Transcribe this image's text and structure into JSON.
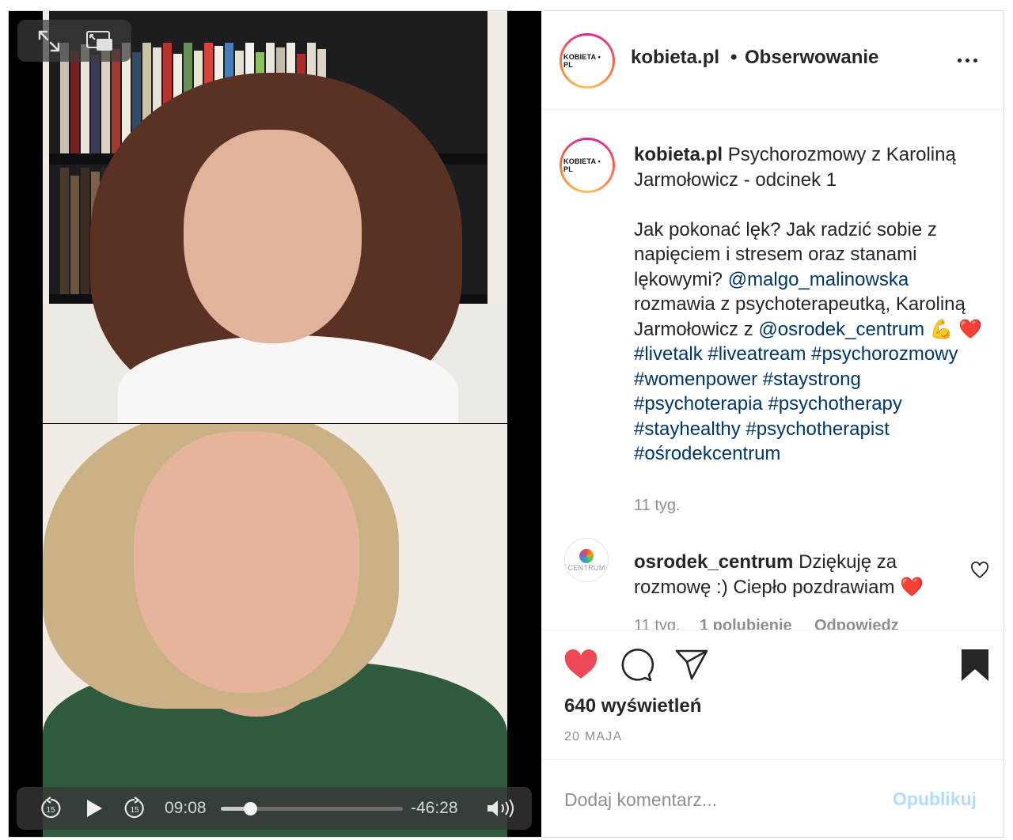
{
  "post": {
    "username": "kobieta.pl",
    "follow_separator": "•",
    "follow_label": "Obserwowanie",
    "avatar_text": "KOBIETA • PL",
    "caption": {
      "username": "kobieta.pl",
      "title": " Psychorozmowy z Karoliną Jarmołowicz - odcinek 1",
      "body_1": "Jak pokonać lęk? Jak radzić sobie z napięciem i stresem oraz stanami lękowymi? ",
      "mention_1": "@malgo_malinowska",
      "body_2": " rozmawia z psychoterapeutką, Karoliną Jarmołowicz z ",
      "mention_2": "@osrodek_centrum",
      "emoji_1": " 💪 ❤️ ",
      "hashtags": "#livetalk #liveatream #psychorozmowy #womenpower #staystrong #psychoterapia #psychotherapy #stayhealthy #psychotherapist #ośrodekcentrum"
    },
    "caption_time": "11 tyg.",
    "comment": {
      "avatar_text": "CENTRUM",
      "username": "osrodek_centrum",
      "text": " Dziękuję za rozmowę :) Ciepło pozdrawiam ❤️",
      "time": "11 tyg.",
      "likes": "1 polubienie",
      "reply": "Odpowiedz"
    },
    "views": "640 wyświetleń",
    "date": "20 MAJA",
    "add_comment_placeholder": "Dodaj komentarz...",
    "publish_label": "Opublikuj",
    "liked": true,
    "saved": true,
    "like_color": "#ed4956"
  },
  "video": {
    "elapsed": "09:08",
    "remaining": "-46:28",
    "progress": 0.165,
    "skip_back_label": "15",
    "skip_forward_label": "15",
    "icons": [
      "fullscreen-icon",
      "picture-in-picture-icon",
      "skip-back-15-icon",
      "play-icon",
      "skip-forward-15-icon",
      "volume-icon"
    ]
  }
}
